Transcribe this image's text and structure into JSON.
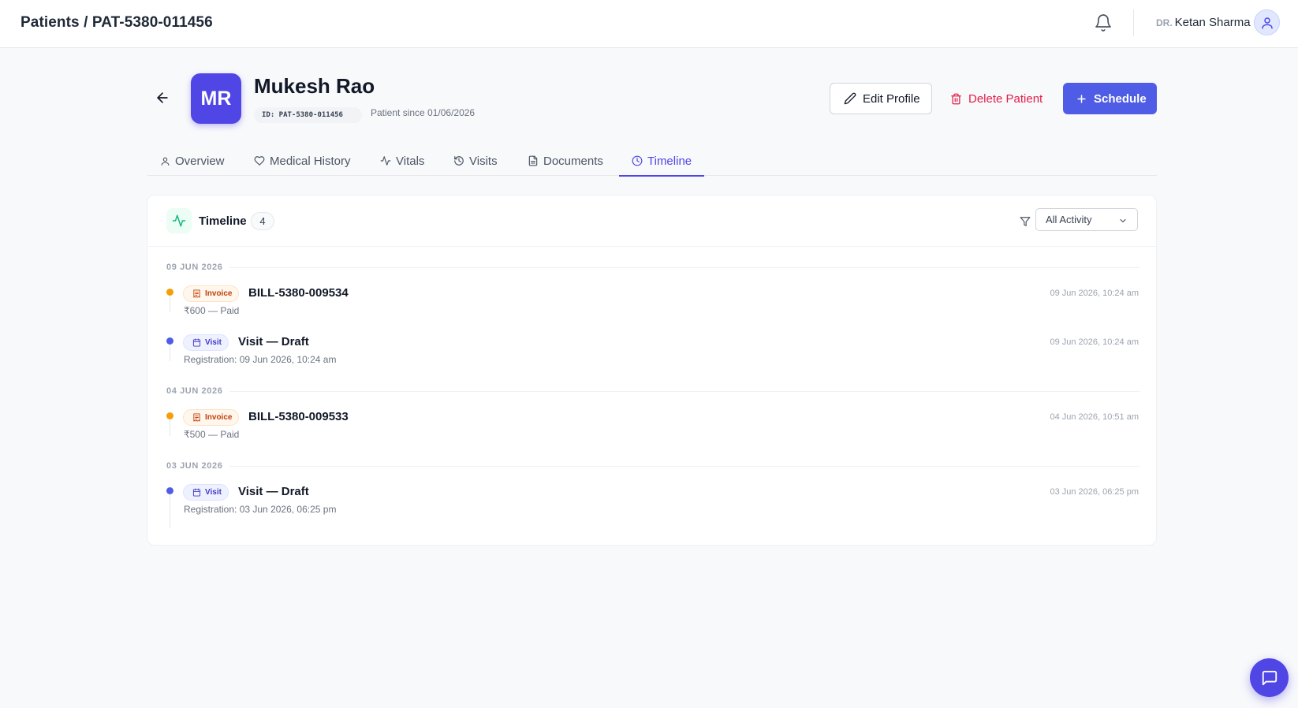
{
  "header": {
    "breadcrumb": "Patients / PAT-5380-011456",
    "user_prefix": "DR.",
    "user_name": "Ketan Sharma"
  },
  "patient": {
    "initials": "MR",
    "name": "Mukesh Rao",
    "id": "ID: PAT-5380-011456",
    "since": "Patient since 01/06/2026"
  },
  "actions": {
    "edit": "Edit Profile",
    "delete": "Delete Patient",
    "schedule": "Schedule"
  },
  "tabs": [
    {
      "label": "Overview",
      "icon": "user-icon"
    },
    {
      "label": "Medical History",
      "icon": "heart-icon"
    },
    {
      "label": "Vitals",
      "icon": "activity-icon"
    },
    {
      "label": "Visits",
      "icon": "history-icon"
    },
    {
      "label": "Documents",
      "icon": "document-icon"
    },
    {
      "label": "Timeline",
      "icon": "clock-icon",
      "active": true
    }
  ],
  "timeline": {
    "title": "Timeline",
    "count": "4",
    "filter_value": "All Activity",
    "groups": [
      {
        "date": "09 JUN 2026",
        "events": [
          {
            "type": "Invoice",
            "title": "BILL-5380-009534",
            "subtitle": "₹600 — Paid",
            "time": "09 Jun 2026, 10:24 am"
          },
          {
            "type": "Visit",
            "title": "Visit — Draft",
            "subtitle": "Registration: 09 Jun 2026, 10:24 am",
            "time": "09 Jun 2026, 10:24 am"
          }
        ]
      },
      {
        "date": "04 JUN 2026",
        "events": [
          {
            "type": "Invoice",
            "title": "BILL-5380-009533",
            "subtitle": "₹500 — Paid",
            "time": "04 Jun 2026, 10:51 am"
          }
        ]
      },
      {
        "date": "03 JUN 2026",
        "events": [
          {
            "type": "Visit",
            "title": "Visit — Draft",
            "subtitle": "Registration: 03 Jun 2026, 06:25 pm",
            "time": "03 Jun 2026, 06:25 pm"
          }
        ]
      }
    ]
  },
  "colors": {
    "accent": "#4f46e5",
    "invoice": "#f59e0b",
    "visit": "#4f5de6",
    "danger": "#e11d48"
  }
}
